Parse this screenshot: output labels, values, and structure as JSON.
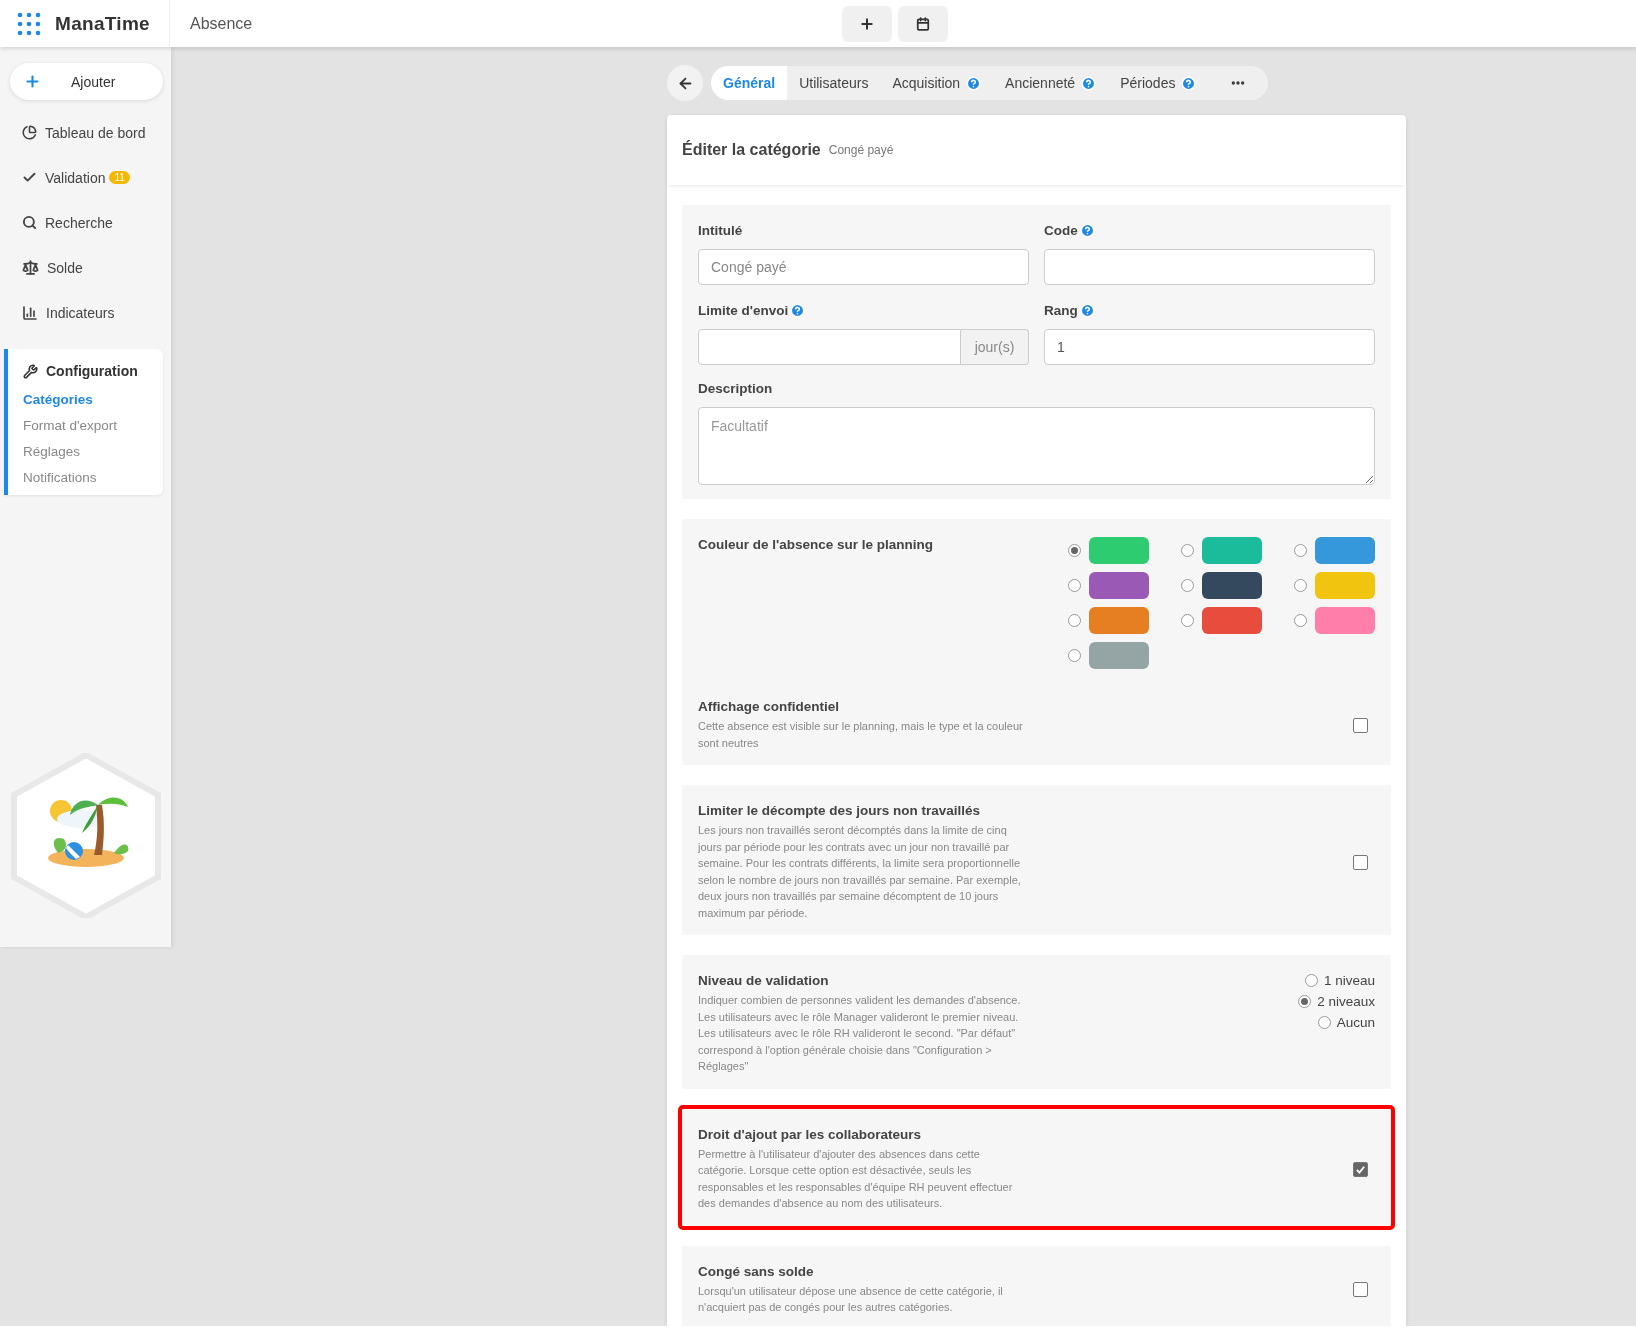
{
  "topbar": {
    "logo": "ManaTime",
    "module": "Absence"
  },
  "sidebar": {
    "add_button": "Ajouter",
    "items": [
      {
        "label": "Tableau de bord"
      },
      {
        "label": "Validation",
        "badge": "11"
      },
      {
        "label": "Recherche"
      },
      {
        "label": "Solde"
      },
      {
        "label": "Indicateurs"
      }
    ],
    "config": {
      "title": "Configuration",
      "items": [
        {
          "label": "Catégories",
          "selected": true
        },
        {
          "label": "Format d'export",
          "selected": false
        },
        {
          "label": "Réglages",
          "selected": false
        },
        {
          "label": "Notifications",
          "selected": false
        }
      ]
    }
  },
  "tabs": [
    {
      "label": "Général",
      "selected": true,
      "help": false
    },
    {
      "label": "Utilisateurs",
      "selected": false,
      "help": false
    },
    {
      "label": "Acquisition",
      "selected": false,
      "help": true
    },
    {
      "label": "Ancienneté",
      "selected": false,
      "help": true
    },
    {
      "label": "Périodes",
      "selected": false,
      "help": true
    }
  ],
  "card": {
    "title": "Éditer la catégorie",
    "subtitle": "Congé payé"
  },
  "fields": [
    {
      "label": "Intitulé",
      "help": false,
      "placeholder": "Congé payé"
    },
    {
      "label": "Code",
      "help": true
    },
    {
      "label": "Limite d'envoi",
      "help": true,
      "suffix": "jour(s)"
    },
    {
      "label": "Rang",
      "help": true,
      "value": "1"
    }
  ],
  "description": {
    "label": "Description",
    "placeholder": "Facultatif"
  },
  "sections": [
    {
      "kind": "colors",
      "title": "Couleur de l'absence sur le planning",
      "colors": [
        {
          "color": "#2ecc71",
          "selected": true
        },
        {
          "color": "#1abc9c",
          "selected": false
        },
        {
          "color": "#3498db",
          "selected": false
        },
        {
          "color": "#9b59b6",
          "selected": false
        },
        {
          "color": "#34495e",
          "selected": false
        },
        {
          "color": "#f1c40f",
          "selected": false
        },
        {
          "color": "#e67e22",
          "selected": false
        },
        {
          "color": "#e74c3c",
          "selected": false
        },
        {
          "color": "#ff7eaa",
          "selected": false
        },
        {
          "color": "#95a5a6",
          "selected": false
        }
      ],
      "sub": {
        "title": "Affichage confidentiel",
        "text": "Cette absence est visible sur le planning, mais le type et la couleur sont neutres",
        "checked": false
      }
    },
    {
      "kind": "checkbox",
      "title": "Limiter le décompte des jours non travaillés",
      "text": "Les jours non travaillés seront décomptés dans la limite de cinq jours par période pour les contrats avec un jour non travaillé par semaine. Pour les contrats différents, la limite sera proportionnelle selon le nombre de jours non travaillés par semaine. Par exemple, deux jours non travaillés par semaine décomptent de 10 jours maximum par période.",
      "checked": false,
      "highlighted": false
    },
    {
      "kind": "radio",
      "title": "Niveau de validation",
      "text": "Indiquer combien de personnes valident les demandes d'absence. Les utilisateurs avec le rôle Manager valideront le premier niveau. Les utilisateurs avec le rôle RH valideront le second. \"Par défaut\" correspond à l'option générale choisie dans \"Configuration > Réglages\"",
      "options": [
        {
          "label": "1 niveau",
          "selected": false
        },
        {
          "label": "2 niveaux",
          "selected": true
        },
        {
          "label": "Aucun",
          "selected": false
        }
      ],
      "highlighted": false
    },
    {
      "kind": "checkbox",
      "title": "Droit d'ajout par les collaborateurs",
      "text": "Permettre à l'utilisateur d'ajouter des absences dans cette catégorie. Lorsque cette option est désactivée, seuls les responsables et les responsables d'équipe RH peuvent effectuer des demandes d'absence au nom des utilisateurs.",
      "checked": true,
      "highlighted": true
    },
    {
      "kind": "checkbox",
      "title": "Congé sans solde",
      "text": "Lorsqu'un utilisateur dépose une absence de cette catégorie, il n'acquiert pas de congés pour les autres catégories.",
      "checked": false,
      "highlighted": false
    }
  ]
}
